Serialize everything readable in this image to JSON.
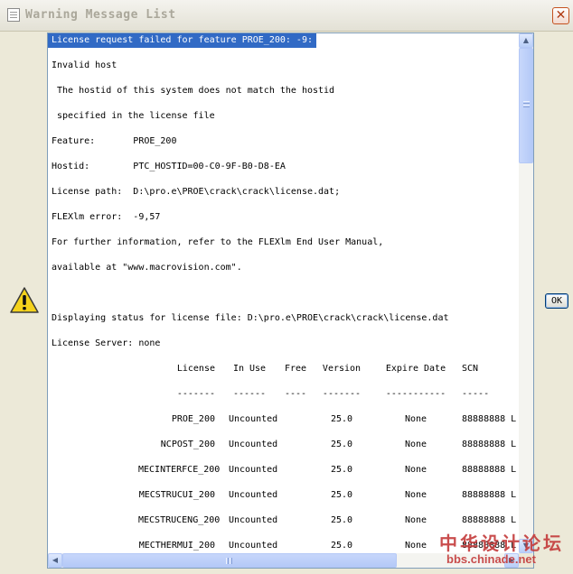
{
  "window": {
    "title": "Warning Message List",
    "close_glyph": "✕"
  },
  "icons": {
    "warning": "warning-icon",
    "close": "close-icon"
  },
  "messages": {
    "highlighted": "License request failed for feature PROE_200: -9:",
    "lines": [
      "Invalid host",
      " The hostid of this system does not match the hostid",
      " specified in the license file",
      "Feature:       PROE_200",
      "Hostid:        PTC_HOSTID=00-C0-9F-B0-D8-EA",
      "License path:  D:\\pro.e\\PROE\\crack\\crack\\license.dat;",
      "FLEXlm error:  -9,57",
      "For further information, refer to the FLEXlm End User Manual,",
      "available at \"www.macrovision.com\".",
      "",
      "Displaying status for license file: D:\\pro.e\\PROE\\crack\\crack\\license.dat",
      "License Server: none"
    ]
  },
  "license_table": {
    "headers": [
      "License",
      "In Use",
      "Free",
      "Version",
      "Expire Date",
      "SCN"
    ],
    "separators": [
      "-------",
      "------",
      "----",
      "-------",
      "-----------",
      "-----"
    ],
    "rows": [
      [
        "PROE_200",
        "Uncounted",
        "",
        "25.0",
        "None",
        "88888888 L"
      ],
      [
        "NCPOST_200",
        "Uncounted",
        "",
        "25.0",
        "None",
        "88888888 L"
      ],
      [
        "MECINTERFCE_200",
        "Uncounted",
        "",
        "25.0",
        "None",
        "88888888 L"
      ],
      [
        "MECSTRUCUI_200",
        "Uncounted",
        "",
        "25.0",
        "None",
        "88888888 L"
      ],
      [
        "MECSTRUCENG_200",
        "Uncounted",
        "",
        "25.0",
        "None",
        "88888888 L"
      ],
      [
        "MECTHERMUI_200",
        "Uncounted",
        "",
        "25.0",
        "None",
        "88888888 L"
      ]
    ]
  },
  "buttons": {
    "ok": "OK"
  },
  "scrollbars": {
    "up": "▲",
    "down": "▼",
    "left": "◀",
    "right": "▶"
  },
  "watermark": {
    "chinese": "中华设计论坛",
    "url": "bbs.chinade.net"
  }
}
